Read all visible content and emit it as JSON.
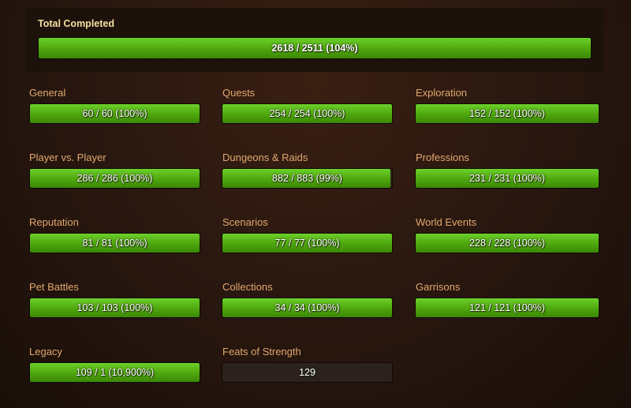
{
  "total": {
    "title": "Total Completed",
    "value": "2618 / 2511 (104%)",
    "progress": 1.0
  },
  "categories": [
    {
      "name": "General",
      "value": "60 / 60 (100%)",
      "progress": 1.0
    },
    {
      "name": "Quests",
      "value": "254 / 254 (100%)",
      "progress": 1.0
    },
    {
      "name": "Exploration",
      "value": "152 / 152 (100%)",
      "progress": 1.0
    },
    {
      "name": "Player vs. Player",
      "value": "286 / 286 (100%)",
      "progress": 1.0
    },
    {
      "name": "Dungeons & Raids",
      "value": "882 / 883 (99%)",
      "progress": 0.99
    },
    {
      "name": "Professions",
      "value": "231 / 231 (100%)",
      "progress": 1.0
    },
    {
      "name": "Reputation",
      "value": "81 / 81 (100%)",
      "progress": 1.0
    },
    {
      "name": "Scenarios",
      "value": "77 / 77 (100%)",
      "progress": 1.0
    },
    {
      "name": "World Events",
      "value": "228 / 228 (100%)",
      "progress": 1.0
    },
    {
      "name": "Pet Battles",
      "value": "103 / 103 (100%)",
      "progress": 1.0
    },
    {
      "name": "Collections",
      "value": "34 / 34 (100%)",
      "progress": 1.0
    },
    {
      "name": "Garrisons",
      "value": "121 / 121 (100%)",
      "progress": 1.0
    },
    {
      "name": "Legacy",
      "value": "109 / 1 (10,900%)",
      "progress": 1.0
    },
    {
      "name": "Feats of Strength",
      "value": "129",
      "progress": 0
    }
  ],
  "colors": {
    "bar_fill": "#4ea60d",
    "bar_empty": "#2b221d",
    "category_text": "#e0a86e",
    "total_title": "#f5dfa0"
  }
}
